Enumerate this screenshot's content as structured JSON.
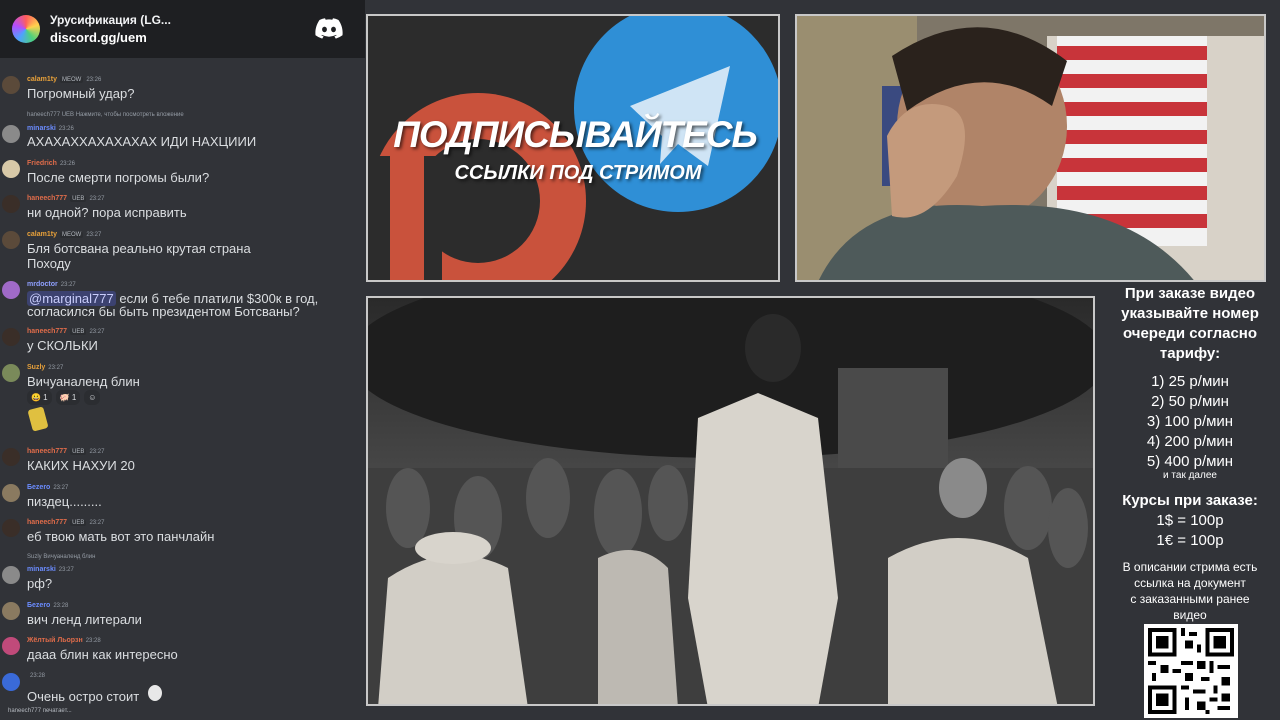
{
  "server": {
    "name": "Урусификация (LG...",
    "link": "discord.gg/uem"
  },
  "messages": [
    {
      "author": "calam1ty",
      "badge": "MEOW",
      "time": "23:26",
      "text": "Погромный удар?",
      "name_color": "#e8a13a"
    },
    {
      "reply": "haneech777 UEB Нажмите, чтобы посмотреть вложение",
      "author": "minarski",
      "time": "23:26",
      "text": "АХАХАХХАХАХАХАХ ИДИ НАХЦИИИ",
      "name_color": "#6b8cff"
    },
    {
      "author": "Friedrich",
      "time": "23:26",
      "text": "После смерти погромы были?",
      "name_color": "#e06c4a"
    },
    {
      "author": "haneech777",
      "badge": "UEB",
      "time": "23:27",
      "text": "ни одной? пора исправить",
      "name_color": "#e06c4a"
    },
    {
      "author": "calam1ty",
      "badge": "MEOW",
      "time": "23:27",
      "text": "Бля ботсвана реально крутая страна",
      "text2": "Походу",
      "name_color": "#e8a13a"
    },
    {
      "author": "mrdoctor",
      "time": "23:27",
      "mention": "@marginal777",
      "text": " если б тебе платили $300к в год,",
      "text2": "согласился бы быть президентом Ботсваны?",
      "name_color": "#8fa0ff"
    },
    {
      "author": "haneech777",
      "badge": "UEB",
      "time": "23:27",
      "text": "у СКОЛЬКИ",
      "name_color": "#e06c4a"
    },
    {
      "author": "Suzly",
      "time": "23:27",
      "text": "Вичуаналенд блин",
      "reactions": [
        "😀 1",
        "🐖 1",
        "☺"
      ],
      "name_color": "#e8a13a"
    },
    {
      "author": "haneech777",
      "badge": "UEB",
      "time": "23:27",
      "text": "КАКИХ НАХУИ 20",
      "name_color": "#e06c4a"
    },
    {
      "author": "Бezero",
      "time": "23:27",
      "text": "пиздец.........",
      "name_color": "#6b8cff"
    },
    {
      "author": "haneech777",
      "badge": "UEB",
      "time": "23:27",
      "text": "еб твою мать вот это панчлайн",
      "name_color": "#e06c4a"
    },
    {
      "reply": "Suzly Вичуаналенд блин",
      "author": "minarski",
      "time": "23:27",
      "text": "рф?",
      "name_color": "#6b8cff"
    },
    {
      "author": "Бezero",
      "time": "23:28",
      "text": "вич ленд литерали",
      "name_color": "#6b8cff"
    },
    {
      "author": "Жёлтый Льорзн",
      "time": "23:28",
      "text": "дааа блин как интересно",
      "name_color": "#e06c4a"
    },
    {
      "author": "",
      "time": "23:28",
      "text": "Очень остро стоит",
      "name_color": "#e06c4a"
    }
  ],
  "typing": "haneech777 печатает...",
  "banner": {
    "title": "ПОДПИСЫВАЙТЕСЬ",
    "subtitle": "ССЫЛКИ ПОД СТРИМОМ",
    "colors": {
      "patreon": "#c9523c",
      "telegram": "#2f8fd6"
    }
  },
  "info": {
    "lines": [
      "При заказе видео",
      "указывайте номер",
      "очереди согласно",
      "тарифу:"
    ],
    "tariffs": [
      "1) 25 р/мин",
      "2) 50 р/мин",
      "3) 100 р/мин",
      "4) 200 р/мин",
      "5) 400 р/мин"
    ],
    "etc": "и так далее",
    "rates_title": "Курсы при заказе:",
    "rates": [
      "1$ = 100р",
      "1€ = 100р"
    ],
    "desc": [
      "В описании стрима есть",
      "ссылка на документ",
      "с заказанными ранее",
      "видео"
    ]
  }
}
